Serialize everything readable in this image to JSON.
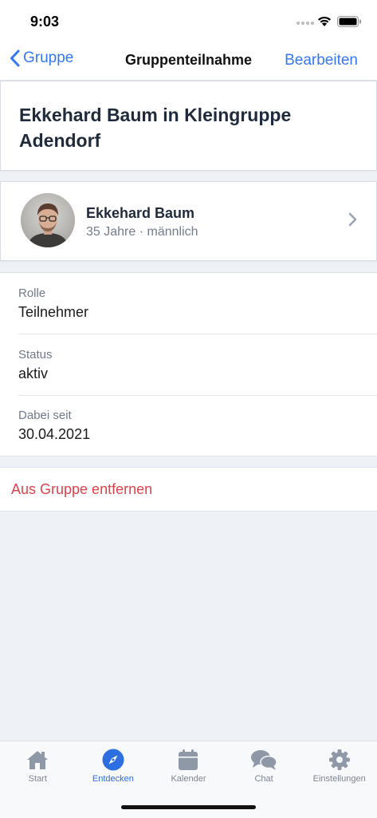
{
  "status_bar": {
    "time": "9:03",
    "wifi_icon": "wifi-icon",
    "battery_icon": "battery-icon"
  },
  "nav": {
    "back_label": "Gruppe",
    "title": "Gruppenteilnahme",
    "edit_label": "Bearbeiten"
  },
  "title_card": {
    "title": "Ekkehard Baum in Kleingruppe Adendorf"
  },
  "person": {
    "name": "Ekkehard Baum",
    "meta": "35 Jahre · männlich"
  },
  "details": [
    {
      "label": "Rolle",
      "value": "Teilnehmer"
    },
    {
      "label": "Status",
      "value": "aktiv"
    },
    {
      "label": "Dabei seit",
      "value": "30.04.2021"
    }
  ],
  "remove_label": "Aus Gruppe entfernen",
  "tabs": [
    {
      "label": "Start",
      "icon": "home-icon",
      "active": false
    },
    {
      "label": "Entdecken",
      "icon": "compass-icon",
      "active": true
    },
    {
      "label": "Kalender",
      "icon": "calendar-icon",
      "active": false
    },
    {
      "label": "Chat",
      "icon": "chat-icon",
      "active": false
    },
    {
      "label": "Einstellungen",
      "icon": "gear-icon",
      "active": false
    }
  ],
  "colors": {
    "accent": "#3478f6",
    "danger": "#e2414b",
    "tab_active": "#2d6fe0",
    "tab_inactive": "#8f98a6",
    "background": "#eef1f6"
  }
}
